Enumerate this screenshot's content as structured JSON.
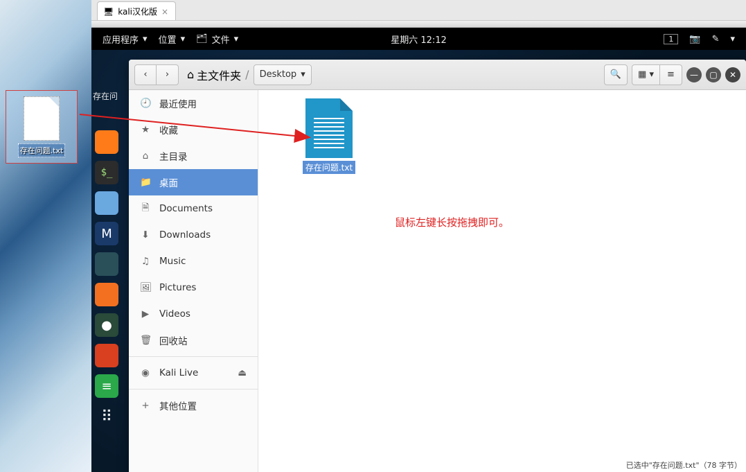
{
  "host_desktop": {
    "dragged_file": "存在问题.txt"
  },
  "vm_tab": {
    "title": "kali汉化版"
  },
  "gnome_bar": {
    "apps": "应用程序",
    "places": "位置",
    "files": "文件",
    "clock": "星期六 12:12",
    "workspace": "1"
  },
  "guest_desktop_file": "存在问",
  "dock": [
    {
      "id": "firefox",
      "glyph": "🦊"
    },
    {
      "id": "terminal",
      "glyph": "$_"
    },
    {
      "id": "files",
      "glyph": "📁"
    },
    {
      "id": "metasploit",
      "glyph": "M"
    },
    {
      "id": "team",
      "glyph": "👥"
    },
    {
      "id": "burp",
      "glyph": "⚡"
    },
    {
      "id": "misc",
      "glyph": "●"
    },
    {
      "id": "script",
      "glyph": "❓"
    },
    {
      "id": "green",
      "glyph": "≡"
    },
    {
      "id": "apps-grid",
      "glyph": "⋮⋮⋮"
    }
  ],
  "nautilus": {
    "path_home": "主文件夹",
    "path_segment": "Desktop",
    "sidebar": [
      {
        "icon": "🕘",
        "label": "最近使用",
        "id": "recent"
      },
      {
        "icon": "★",
        "label": "收藏",
        "id": "starred"
      },
      {
        "icon": "⌂",
        "label": "主目录",
        "id": "home"
      },
      {
        "icon": "📁",
        "label": "桌面",
        "id": "desktop",
        "active": true
      },
      {
        "icon": "🗎",
        "label": "Documents",
        "id": "documents"
      },
      {
        "icon": "⬇",
        "label": "Downloads",
        "id": "downloads"
      },
      {
        "icon": "♫",
        "label": "Music",
        "id": "music"
      },
      {
        "icon": "🖼",
        "label": "Pictures",
        "id": "pictures"
      },
      {
        "icon": "▶",
        "label": "Videos",
        "id": "videos"
      },
      {
        "icon": "🗑",
        "label": "回收站",
        "id": "trash"
      },
      {
        "divider": true
      },
      {
        "icon": "◉",
        "label": "Kali Live",
        "id": "kali-live",
        "eject": "⏏"
      },
      {
        "divider": true
      },
      {
        "icon": "+",
        "label": "其他位置",
        "id": "other"
      }
    ],
    "file": {
      "name": "存在问题.txt"
    },
    "status": "已选中\"存在问题.txt\"（78 字节）"
  },
  "annotation": "鼠标左键长按拖拽即可。",
  "watermark": ""
}
